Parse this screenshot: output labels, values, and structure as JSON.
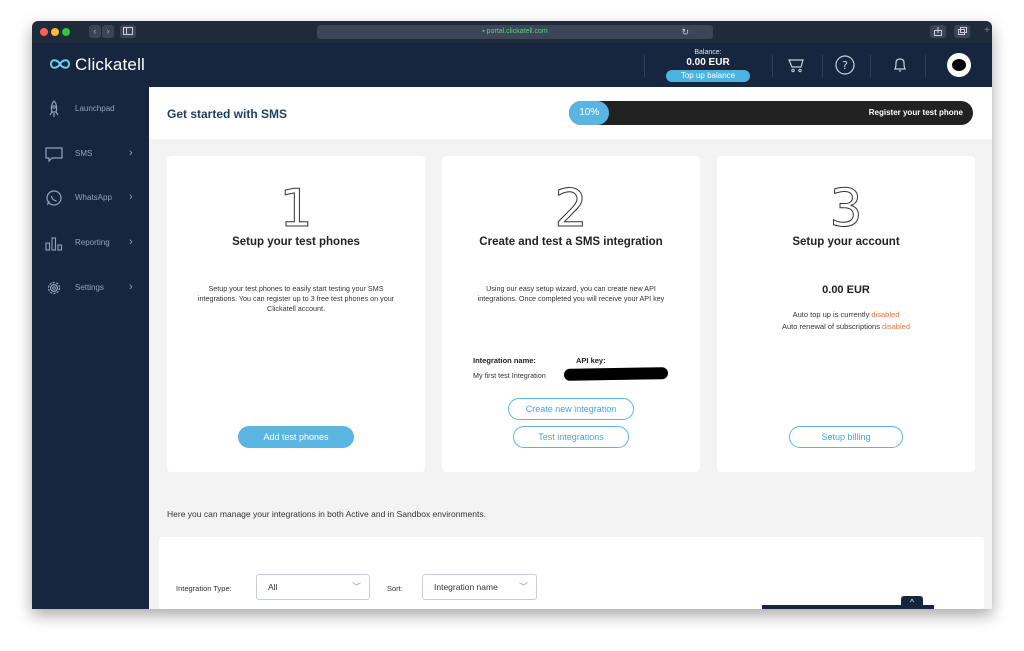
{
  "browser": {
    "url": "portal.clickatell.com",
    "back_glyph": "‹",
    "forward_glyph": "›",
    "reload_glyph": "↻",
    "plus_glyph": "+"
  },
  "header": {
    "logo_text": "Clickatell",
    "balance_label": "Balance:",
    "balance_value": "0.00 EUR",
    "topup_label": "Top up balance"
  },
  "sidebar": {
    "items": [
      {
        "label": "Launchpad",
        "chevron": ""
      },
      {
        "label": "SMS",
        "chevron": "›"
      },
      {
        "label": "WhatsApp",
        "chevron": "›"
      },
      {
        "label": "Reporting",
        "chevron": "›"
      },
      {
        "label": "Settings",
        "chevron": "›"
      }
    ]
  },
  "page": {
    "title": "Get started with SMS",
    "progress": {
      "percent_label": "10%",
      "percent": 10,
      "label": "Register your test phone"
    }
  },
  "cards": [
    {
      "number": "1",
      "title": "Setup your test phones",
      "description": "Setup your test phones to easily start testing your SMS integrations. You can register up to 3 free test phones on your Clickatell account.",
      "button": "Add test phones"
    },
    {
      "number": "2",
      "title": "Create and test a SMS integration",
      "description": "Using our easy setup wizard, you can create new API integrations. Once completed you will receive your API key",
      "integration_name_label": "Integration name:",
      "api_key_label": "API key:",
      "integration_name_value": "My first test Integration",
      "button_create": "Create new integration",
      "button_test": "Test integrations"
    },
    {
      "number": "3",
      "title": "Setup your account",
      "amount": "0.00 EUR",
      "auto_topup_text": "Auto top up is currently",
      "auto_topup_status": "disabled",
      "auto_renewal_text": "Auto renewal of subscriptions",
      "auto_renewal_status": "disabled",
      "button": "Setup billing"
    }
  ],
  "manage": {
    "text": "Here you can manage your integrations in both Active and in Sandbox environments.",
    "integration_type_label": "Integration Type:",
    "integration_type_value": "All",
    "sort_label": "Sort:",
    "sort_value": "Integration name",
    "chevron": "﹀",
    "scroll_top_glyph": "^"
  },
  "colors": {
    "navy": "#16263f",
    "accent": "#5bb5e3",
    "disabled": "#e8743a"
  }
}
